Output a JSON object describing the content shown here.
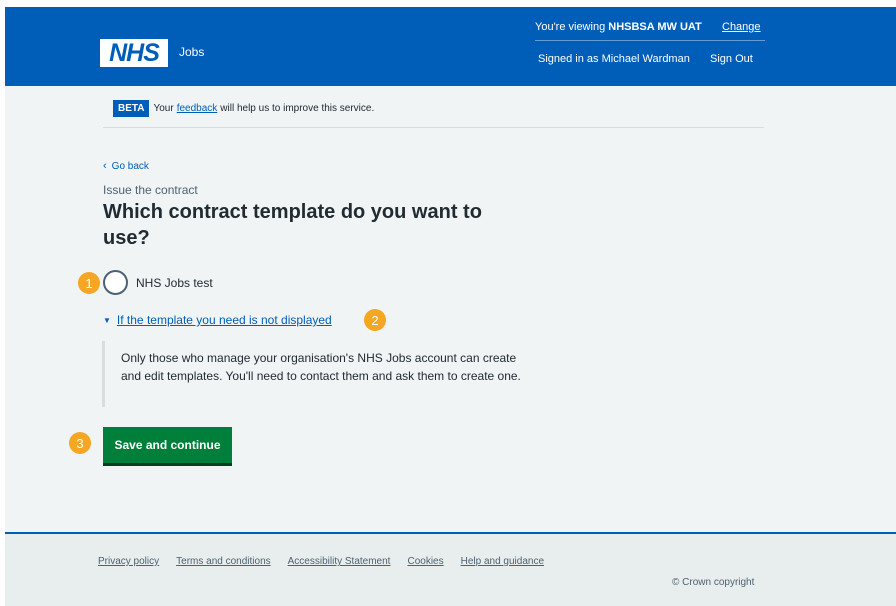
{
  "header": {
    "logo_text": "NHS",
    "service_name": "Jobs",
    "viewing_prefix": "You're viewing",
    "viewing_org": "NHSBSA MW UAT",
    "change_label": "Change",
    "signed_in_text": "Signed in as Michael Wardman",
    "sign_out_label": "Sign Out"
  },
  "beta_banner": {
    "tag": "BETA",
    "prefix": "Your",
    "link": "feedback",
    "suffix": "will help us to improve this service."
  },
  "back_link": "Go back",
  "caption": "Issue the contract",
  "heading": "Which contract template do you want to use?",
  "options": [
    {
      "label": "NHS Jobs test",
      "selected": false
    }
  ],
  "details": {
    "summary": "If the template you need is not displayed",
    "body": "Only those who manage your organisation's NHS Jobs account can create and edit templates. You'll need to contact them and ask them to create one."
  },
  "save_button": "Save and continue",
  "markers": [
    "1",
    "2",
    "3"
  ],
  "footer": {
    "links": [
      "Privacy policy",
      "Terms and conditions",
      "Accessibility Statement",
      "Cookies",
      "Help and guidance"
    ],
    "copyright": "© Crown copyright"
  },
  "colors": {
    "nhs_blue": "#005eb8",
    "button_green": "#007f3b",
    "marker_orange": "#f5a623",
    "page_bg": "#f0f4f5"
  }
}
